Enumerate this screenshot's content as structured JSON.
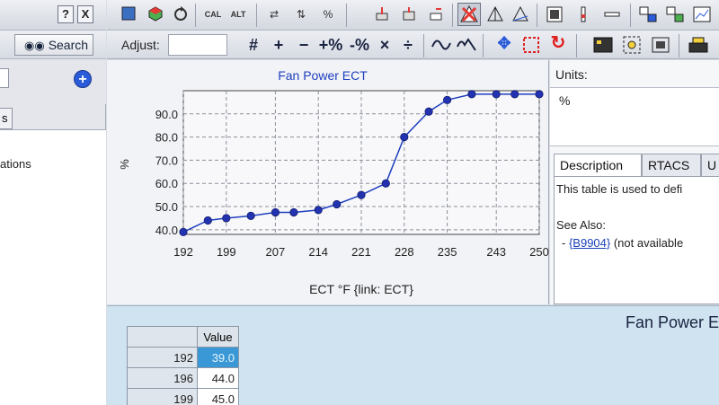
{
  "left": {
    "help_btn": "?",
    "close_btn": "X",
    "search_label": "Search",
    "search_icon": "binoculars-icon",
    "tab_stub": "s",
    "tree_text": "ations"
  },
  "toolbar": {
    "adjust_label": "Adjust:",
    "adjust_value": "",
    "ops": [
      "#",
      "+",
      "−",
      "+%",
      "-%",
      "×",
      "÷"
    ],
    "icons": [
      "save-icon",
      "cube-icon",
      "refresh-icon",
      "cal-icon",
      "alt-icon",
      "swap-icon",
      "percent-icon",
      "load-icon",
      "write-icon",
      "minimize-icon",
      "warning-icon",
      "axis-icon",
      "axis-alt-icon",
      "grid-icon",
      "slider-icon",
      "dash-icon",
      "copy-icon",
      "copy-alt-icon",
      "smooth-icon",
      "step-icon",
      "target-icon",
      "fill-icon",
      "reset-icon"
    ],
    "cal_text": "CAL",
    "alt_text": "ALT"
  },
  "chart_data": {
    "type": "line",
    "title": "Fan Power ECT",
    "xlabel": "ECT °F {link: ECT}",
    "ylabel": "%",
    "x_ticks": [
      "192",
      "199",
      "207",
      "214",
      "221",
      "228",
      "235",
      "243",
      "250"
    ],
    "y_ticks": [
      "40.0",
      "50.0",
      "60.0",
      "70.0",
      "80.0",
      "90.0"
    ],
    "xlim": [
      192,
      250
    ],
    "ylim": [
      38,
      100
    ],
    "grid": true,
    "series": [
      {
        "x": [
          192,
          196,
          199,
          203,
          207,
          210,
          214,
          217,
          221,
          225,
          228,
          232,
          235,
          239,
          243,
          246,
          250
        ],
        "values": [
          39.0,
          44.0,
          45.0,
          46.0,
          47.5,
          47.5,
          48.5,
          51.0,
          55.0,
          60.0,
          80.0,
          91.0,
          96.0,
          98.5,
          98.5,
          98.5,
          98.5
        ]
      }
    ],
    "colors": {
      "line": "#1f3fbf",
      "marker": "#2232b0",
      "grid": "#8a8f99"
    }
  },
  "right": {
    "units_label": "Units:",
    "units_value": "%",
    "tabs": [
      "Description",
      "RTACS",
      "U"
    ],
    "desc_line": "This table is used to defi",
    "see_also": "See Also:",
    "link_prefix": "- ",
    "link_text": "{B9904}",
    "link_suffix": " (not available"
  },
  "bottom": {
    "title": "Fan Power E",
    "col_header": "Value",
    "rows": [
      {
        "key": "192",
        "value": "39.0"
      },
      {
        "key": "196",
        "value": "44.0"
      },
      {
        "key": "199",
        "value": "45.0"
      }
    ]
  }
}
